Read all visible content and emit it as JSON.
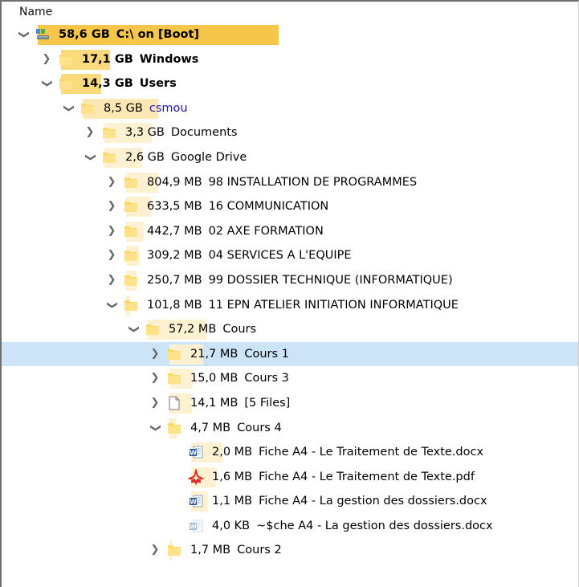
{
  "header": {
    "name_label": "Name"
  },
  "colors": {
    "bar_strong": "#f5c64a",
    "bar_mid": "#fbd97d",
    "bar_light": "#fde8b3",
    "bar_pale": "#fef1d2",
    "folder_yellow": "#ffd864",
    "selection": "#cce4f7",
    "name_blue": "#1a1aa8"
  },
  "tree": {
    "rows": [
      {
        "size": "58,6 GB",
        "name": "C:\\ on [Boot]",
        "level": 0,
        "state": "expanded",
        "icon": "drive-icon",
        "bold": true,
        "share": 1.0
      },
      {
        "size": "17,1 GB",
        "name": "Windows",
        "level": 1,
        "state": "collapsed",
        "icon": "folder-icon",
        "bold": true,
        "share": 0.29
      },
      {
        "size": "14,3 GB",
        "name": "Users",
        "level": 1,
        "state": "expanded",
        "icon": "folder-icon",
        "bold": true,
        "share": 0.24
      },
      {
        "size": "8,5 GB",
        "name": "csmou",
        "level": 2,
        "state": "expanded",
        "icon": "folder-icon",
        "bold": false,
        "blue": true,
        "share": 0.59
      },
      {
        "size": "3,3 GB",
        "name": "Documents",
        "level": 3,
        "state": "collapsed",
        "icon": "folder-icon",
        "share": 0.39
      },
      {
        "size": "2,6 GB",
        "name": "Google Drive",
        "level": 3,
        "state": "expanded",
        "icon": "folder-icon",
        "share": 0.31
      },
      {
        "size": "804,9 MB",
        "name": "98 INSTALLATION DE PROGRAMMES",
        "level": 4,
        "state": "collapsed",
        "icon": "folder-icon",
        "share": 0.31
      },
      {
        "size": "633,5 MB",
        "name": "16 COMMUNICATION",
        "level": 4,
        "state": "collapsed",
        "icon": "folder-icon",
        "share": 0.24
      },
      {
        "size": "442,7 MB",
        "name": "02 AXE FORMATION",
        "level": 4,
        "state": "collapsed",
        "icon": "folder-icon",
        "share": 0.17
      },
      {
        "size": "309,2 MB",
        "name": "04 SERVICES A L'EQUIPE",
        "level": 4,
        "state": "collapsed",
        "icon": "folder-icon",
        "share": 0.12
      },
      {
        "size": "250,7 MB",
        "name": "99 DOSSIER TECHNIQUE (INFORMATIQUE)",
        "level": 4,
        "state": "collapsed",
        "icon": "folder-icon",
        "share": 0.1
      },
      {
        "size": "101,8 MB",
        "name": "11 EPN ATELIER INITIATION INFORMATIQUE",
        "level": 4,
        "state": "expanded",
        "icon": "folder-icon",
        "share": 0.04
      },
      {
        "size": "57,2 MB",
        "name": "Cours",
        "level": 5,
        "state": "expanded",
        "icon": "folder-icon",
        "share": 0.56
      },
      {
        "size": "21,7 MB",
        "name": "Cours 1",
        "level": 6,
        "state": "collapsed",
        "icon": "folder-icon",
        "share": 0.38,
        "selected": true
      },
      {
        "size": "15,0 MB",
        "name": "Cours 3",
        "level": 6,
        "state": "collapsed",
        "icon": "folder-icon",
        "share": 0.26
      },
      {
        "size": "14,1 MB",
        "name": "[5 Files]",
        "level": 6,
        "state": "collapsed",
        "icon": "file-icon",
        "share": 0.25
      },
      {
        "size": "4,7 MB",
        "name": "Cours 4",
        "level": 6,
        "state": "expanded",
        "icon": "folder-icon",
        "share": 0.08
      },
      {
        "size": "2,0 MB",
        "name": "Fiche A4 - Le Traitement de Texte.docx",
        "level": 7,
        "state": "leaf",
        "icon": "word-icon",
        "share": 0.43
      },
      {
        "size": "1,6 MB",
        "name": "Fiche A4 - Le Traitement de Texte.pdf",
        "level": 7,
        "state": "leaf",
        "icon": "pdf-icon",
        "share": 0.34
      },
      {
        "size": "1,1 MB",
        "name": "Fiche A4 - La gestion des dossiers.docx",
        "level": 7,
        "state": "leaf",
        "icon": "word-icon",
        "share": 0.23
      },
      {
        "size": "4,0 KB",
        "name": "~$che A4 - La gestion des dossiers.docx",
        "level": 7,
        "state": "leaf",
        "icon": "word-temp-icon",
        "share": 0.0
      },
      {
        "size": "1,7 MB",
        "name": "Cours 2",
        "level": 6,
        "state": "collapsed",
        "icon": "folder-icon",
        "share": 0.03
      }
    ]
  }
}
